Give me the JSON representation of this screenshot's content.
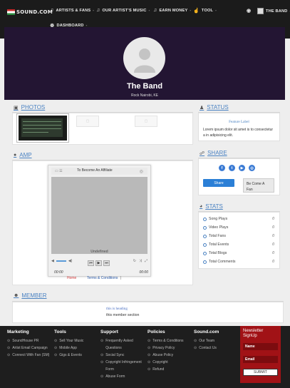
{
  "nav": {
    "logo_text": "SOUND.COM",
    "items": [
      {
        "label": "ARTISTS & FANS",
        "icon": "music-note-icon"
      },
      {
        "label": "OUR ARTIST'S MUSIC",
        "icon": "music-note-icon"
      },
      {
        "label": "EARN MONEY",
        "icon": "music-note-icon"
      },
      {
        "label": "TOOL",
        "icon": "thumbs-up-icon"
      },
      {
        "label": "THE BAND",
        "icon": "avatar-icon"
      },
      {
        "label": "DASHBOARD",
        "icon": "dashboard-icon"
      }
    ],
    "caret": "-"
  },
  "profile": {
    "name": "The Band",
    "location": "Rock Nairobi, KE"
  },
  "photos": {
    "heading": "PHOTOS"
  },
  "amp": {
    "heading": "AMP",
    "player_title": "To Become An Affiliate",
    "track": "Undefined",
    "time_start": "00:00",
    "time_end": "00:00",
    "link_home": "Home",
    "link_terms": "Terms & Conditions",
    "separator": "|"
  },
  "status": {
    "heading": "STATUS",
    "feature_label": "Feature Label",
    "text": "Lorem ipsum dolor sit amet is to consectetur a in adipisicing elit."
  },
  "share": {
    "heading": "SHARE",
    "social": [
      "f",
      "t",
      "▶",
      "◎"
    ],
    "share_button": "Share",
    "fan_button": "Be Come A Fan"
  },
  "stats": {
    "heading": "STATS",
    "rows": [
      {
        "label": "Song Plays",
        "value": "0"
      },
      {
        "label": "Video Plays",
        "value": "0"
      },
      {
        "label": "Total Fans",
        "value": "0"
      },
      {
        "label": "Total Events",
        "value": "0"
      },
      {
        "label": "Total Blogs",
        "value": "0"
      },
      {
        "label": "Total Comments",
        "value": "0"
      }
    ]
  },
  "member": {
    "heading": "MEMBER",
    "title": "this is heading",
    "subtitle": "this member section"
  },
  "footer": {
    "marketing": {
      "heading": "Marketing",
      "items": [
        "SoundHouse PR",
        "Artist Email Campaign",
        "Connect With Fan (SM)"
      ]
    },
    "tools": {
      "heading": "Tools",
      "items": [
        "Sell Your Music",
        "Mobile App",
        "Gigs & Events"
      ]
    },
    "support": {
      "heading": "Support",
      "items": [
        "Frequently Asked Questions",
        "Social Sync",
        "Copyright Infringement Form",
        "Abuse Form"
      ]
    },
    "policies": {
      "heading": "Policies",
      "items": [
        "Terms & Conditions",
        "Privacy Policy",
        "Abuse Policy",
        "Copyright",
        "Refund"
      ]
    },
    "soundcom": {
      "heading": "Sound.com",
      "items": [
        "Our Team",
        "Contact Us"
      ]
    },
    "newsletter": {
      "heading": "Newsletter SignUp",
      "name_placeholder": "Name",
      "email_placeholder": "Email",
      "submit": "SUBMIT"
    }
  },
  "colors": {
    "nav_bg": "#1b1b1b",
    "hero_bg": "#231533",
    "link": "#4a82c2",
    "signup_bg": "#a11216"
  }
}
